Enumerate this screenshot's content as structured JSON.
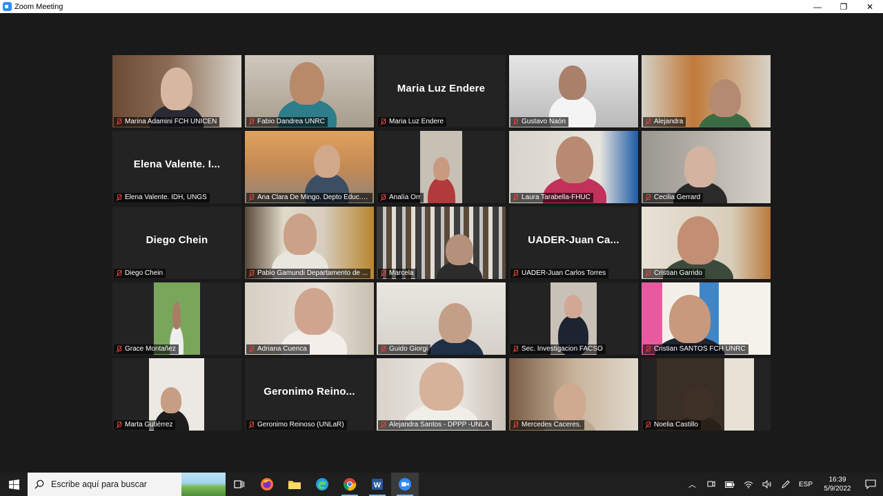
{
  "window": {
    "title": "Zoom Meeting",
    "minimize": "—",
    "maximize": "❐",
    "close": "✕"
  },
  "participants": [
    {
      "name": "Marina Adamini FCH UNICEN",
      "display": "",
      "video": true
    },
    {
      "name": "Fabio Dandrea UNRC",
      "display": "",
      "video": true
    },
    {
      "name": "Maria Luz Endere",
      "display": "Maria Luz Endere",
      "video": false
    },
    {
      "name": "Gustavo Naón",
      "display": "",
      "video": true
    },
    {
      "name": "Alejandra",
      "display": "",
      "video": true
    },
    {
      "name": "Elena Valente. IDH, UNGS",
      "display": "Elena  Valente.  I...",
      "video": false
    },
    {
      "name": "Ana Clara De Mingo. Depto Educ.U...",
      "display": "",
      "video": true
    },
    {
      "name": "Analía Orr",
      "display": "",
      "video": true
    },
    {
      "name": "Laura Tarabella-FHUC",
      "display": "",
      "video": true
    },
    {
      "name": "Cecilia Gerrard",
      "display": "",
      "video": true
    },
    {
      "name": "Diego Chein",
      "display": "Diego Chein",
      "video": false
    },
    {
      "name": "Pablo Gamundi Departamento de ...",
      "display": "",
      "video": true
    },
    {
      "name": "Marcela",
      "display": "",
      "video": true
    },
    {
      "name": "UADER-Juan Carlos Torres",
      "display": "UADER-Juan  Ca...",
      "video": false
    },
    {
      "name": "Cristian Garrido",
      "display": "",
      "video": true
    },
    {
      "name": "Grace Montañez",
      "display": "",
      "video": true
    },
    {
      "name": "Adriana Cuenca",
      "display": "",
      "video": true
    },
    {
      "name": "Guido Giorgi",
      "display": "",
      "video": true,
      "active": true
    },
    {
      "name": "Sec. Investigacion FACSO",
      "display": "",
      "video": true
    },
    {
      "name": "Cristian SANTOS FCH UNRC",
      "display": "",
      "video": true
    },
    {
      "name": "Marta Gutiérrez",
      "display": "",
      "video": true
    },
    {
      "name": "Geronimo Reinoso (UNLaR)",
      "display": "Geronimo  Reino...",
      "video": false
    },
    {
      "name": "Alejandra Santos -  DPPP -UNLA",
      "display": "",
      "video": true
    },
    {
      "name": "Mercedes Caceres.",
      "display": "",
      "video": true
    },
    {
      "name": "Noelia Castillo",
      "display": "",
      "video": true
    }
  ],
  "taskbar": {
    "search_placeholder": "Escribe aquí para buscar",
    "apps": [
      "task-view",
      "firefox",
      "file-explorer",
      "edge",
      "chrome",
      "word",
      "zoom"
    ],
    "language": "ESP",
    "time": "16:39",
    "date": "5/9/2022"
  },
  "colors": {
    "active_speaker": "#c5e84d",
    "muted_icon": "#e0443a",
    "zoom_blue": "#2d8cff"
  }
}
